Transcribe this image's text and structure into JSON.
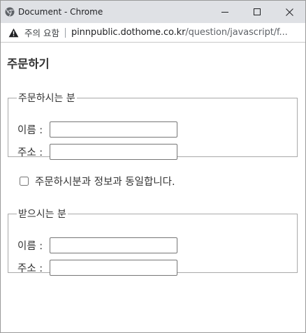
{
  "window": {
    "title": "Document - Chrome",
    "address": {
      "warning": "주의 요함",
      "url_domain": "pinnpublic.dothome.co.kr",
      "url_path": "/question/javascript/f..."
    }
  },
  "page": {
    "heading": "주문하기",
    "orderer": {
      "legend": "주문하시는 분",
      "name_label": "이름 :",
      "name_value": "",
      "address_label": "주소 :",
      "address_value": ""
    },
    "same_info": {
      "label": "주문하시분과 정보과 동일합니다.",
      "checked": false
    },
    "receiver": {
      "legend": "받으시는 분",
      "name_label": "이름 :",
      "name_value": "",
      "address_label": "주소 :",
      "address_value": ""
    }
  }
}
